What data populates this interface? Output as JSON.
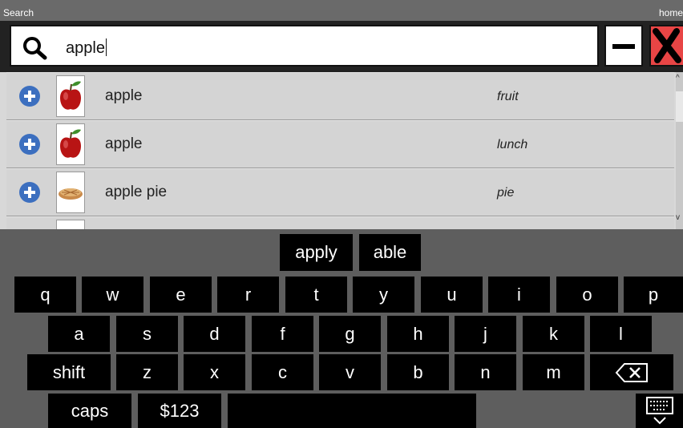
{
  "titlebar": {
    "title": "Search",
    "right": "home"
  },
  "search": {
    "value": "apple"
  },
  "results": [
    {
      "name": "apple",
      "category": "fruit",
      "image": "apple-image"
    },
    {
      "name": "apple",
      "category": "lunch",
      "image": "apple-image"
    },
    {
      "name": "apple pie",
      "category": "pie",
      "image": "apple-pie-image"
    }
  ],
  "suggestions": [
    "apply",
    "able"
  ],
  "keyboard": {
    "row1": [
      "q",
      "w",
      "e",
      "r",
      "t",
      "y",
      "u",
      "i",
      "o",
      "p"
    ],
    "row2": [
      "a",
      "s",
      "d",
      "f",
      "g",
      "h",
      "j",
      "k",
      "l"
    ],
    "row3": [
      "z",
      "x",
      "c",
      "v",
      "b",
      "n",
      "m"
    ],
    "shift": "shift",
    "caps": "caps",
    "symbols": "$123",
    "backspace_icon": "backspace-icon",
    "hide_icon": "keyboard-hide-icon"
  },
  "colors": {
    "close": "#e84545",
    "add": "#3c6fbf"
  }
}
